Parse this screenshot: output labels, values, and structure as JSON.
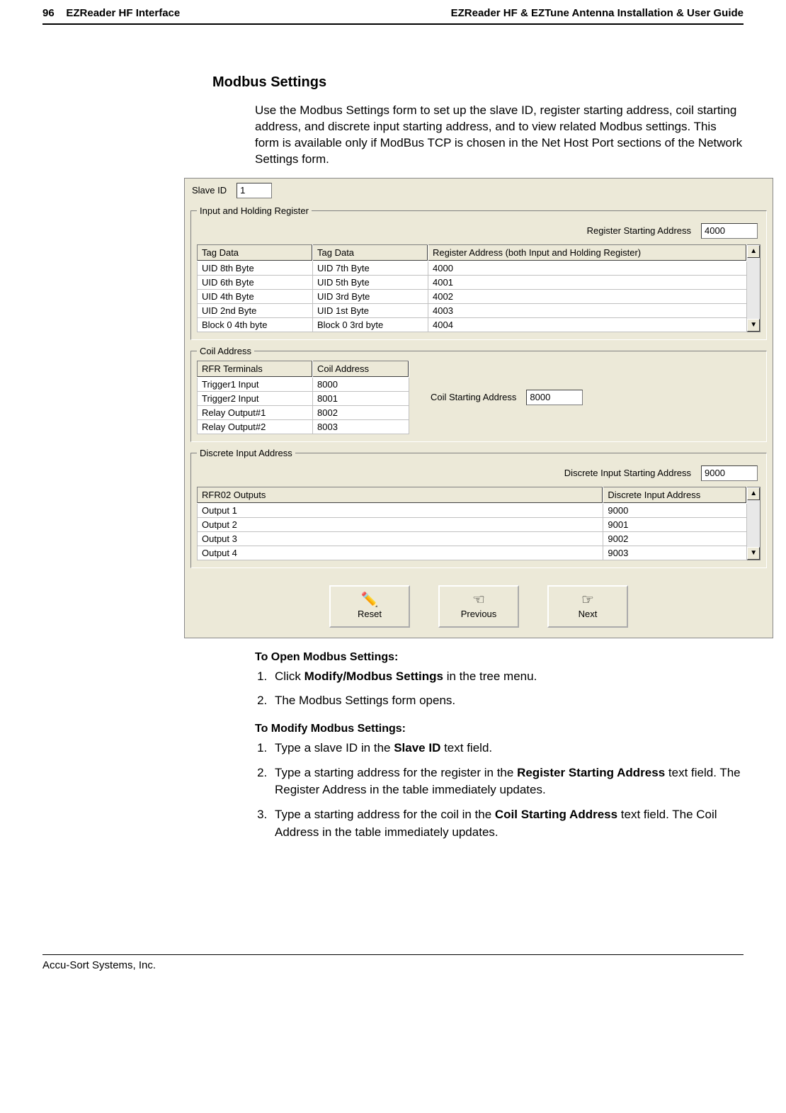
{
  "header": {
    "page_number": "96",
    "left": "EZReader HF Interface",
    "right": "EZReader HF & EZTune Antenna Installation & User Guide"
  },
  "section_title": "Modbus Settings",
  "intro": "Use the Modbus Settings form to set up the slave ID, register starting address, coil starting address, and discrete input starting address, and to view related Modbus settings. This form is available only if ModBus TCP is chosen in the Net Host Port sections of the Network Settings form.",
  "form": {
    "slave_id_label": "Slave ID",
    "slave_id_value": "1",
    "register_group": {
      "legend": "Input and Holding Register",
      "addr_label": "Register Starting Address",
      "addr_value": "4000",
      "headers": [
        "Tag Data",
        "Tag Data",
        "Register Address (both Input and Holding Register)"
      ],
      "rows": [
        [
          "UID 8th Byte",
          "UID 7th Byte",
          "4000"
        ],
        [
          "UID 6th Byte",
          "UID 5th Byte",
          "4001"
        ],
        [
          "UID 4th Byte",
          "UID 3rd Byte",
          "4002"
        ],
        [
          "UID 2nd Byte",
          "UID 1st Byte",
          "4003"
        ],
        [
          "Block 0 4th byte",
          "Block 0 3rd byte",
          "4004"
        ]
      ]
    },
    "coil_group": {
      "legend": "Coil Address",
      "headers": [
        "RFR Terminals",
        "Coil Address"
      ],
      "rows": [
        [
          "Trigger1 Input",
          "8000"
        ],
        [
          "Trigger2 Input",
          "8001"
        ],
        [
          "Relay Output#1",
          "8002"
        ],
        [
          "Relay Output#2",
          "8003"
        ]
      ],
      "addr_label": "Coil Starting Address",
      "addr_value": "8000"
    },
    "discrete_group": {
      "legend": "Discrete Input Address",
      "addr_label": "Discrete Input Starting Address",
      "addr_value": "9000",
      "headers": [
        "RFR02 Outputs",
        "Discrete Input Address"
      ],
      "rows": [
        [
          "Output 1",
          "9000"
        ],
        [
          "Output 2",
          "9001"
        ],
        [
          "Output 3",
          "9002"
        ],
        [
          "Output 4",
          "9003"
        ]
      ]
    },
    "buttons": {
      "reset": "Reset",
      "previous": "Previous",
      "next": "Next"
    }
  },
  "open_heading": "To Open Modbus Settings:",
  "open_steps": [
    "Click <b>Modify/Modbus Settings</b> in the tree menu.",
    "The Modbus Settings form opens."
  ],
  "modify_heading": "To Modify Modbus Settings:",
  "modify_steps": [
    "Type a slave ID in the <b>Slave ID</b> text field.",
    "Type a starting address for the register in the <b>Register Starting Address</b> text field. The Register Address in the table immediately updates.",
    "Type a starting address for the coil in the <b>Coil Starting Address</b> text field. The Coil Address in the table immediately updates."
  ],
  "footer": "Accu-Sort Systems, Inc."
}
